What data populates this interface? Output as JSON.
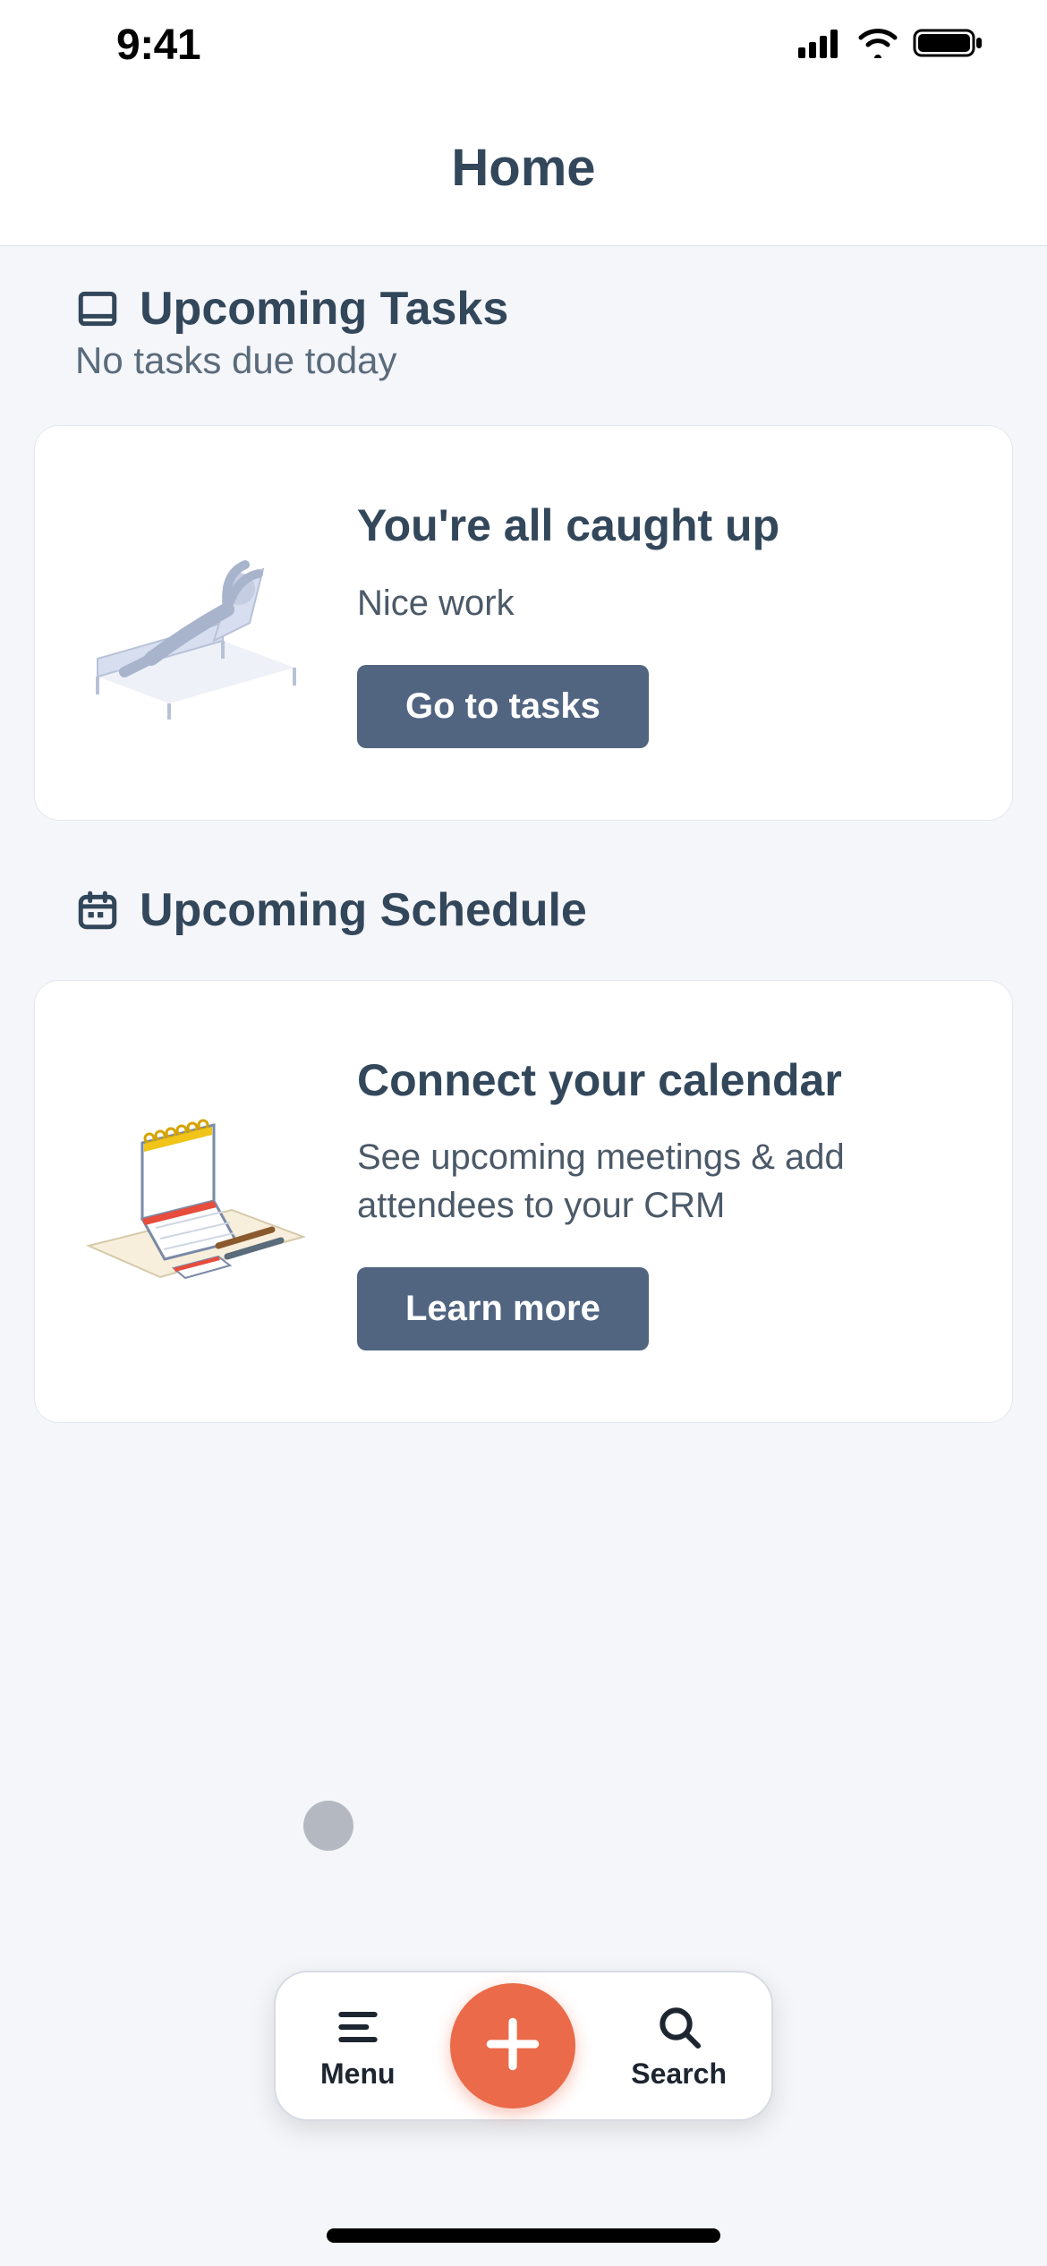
{
  "statusbar": {
    "time": "9:41"
  },
  "nav": {
    "title": "Home"
  },
  "tasks_section": {
    "title": "Upcoming Tasks",
    "subtitle": "No tasks due today",
    "card": {
      "title": "You're all caught up",
      "text": "Nice work",
      "button_label": "Go to tasks"
    }
  },
  "schedule_section": {
    "title": "Upcoming Schedule",
    "card": {
      "title": "Connect your calendar",
      "text": "See upcoming meetings & add attendees to your CRM",
      "button_label": "Learn more"
    }
  },
  "bottom_bar": {
    "menu_label": "Menu",
    "search_label": "Search"
  },
  "colors": {
    "text_primary": "#33475b",
    "button_bg": "#516581",
    "fab_bg": "#ea6a49",
    "page_bg": "#f5f6fa"
  }
}
